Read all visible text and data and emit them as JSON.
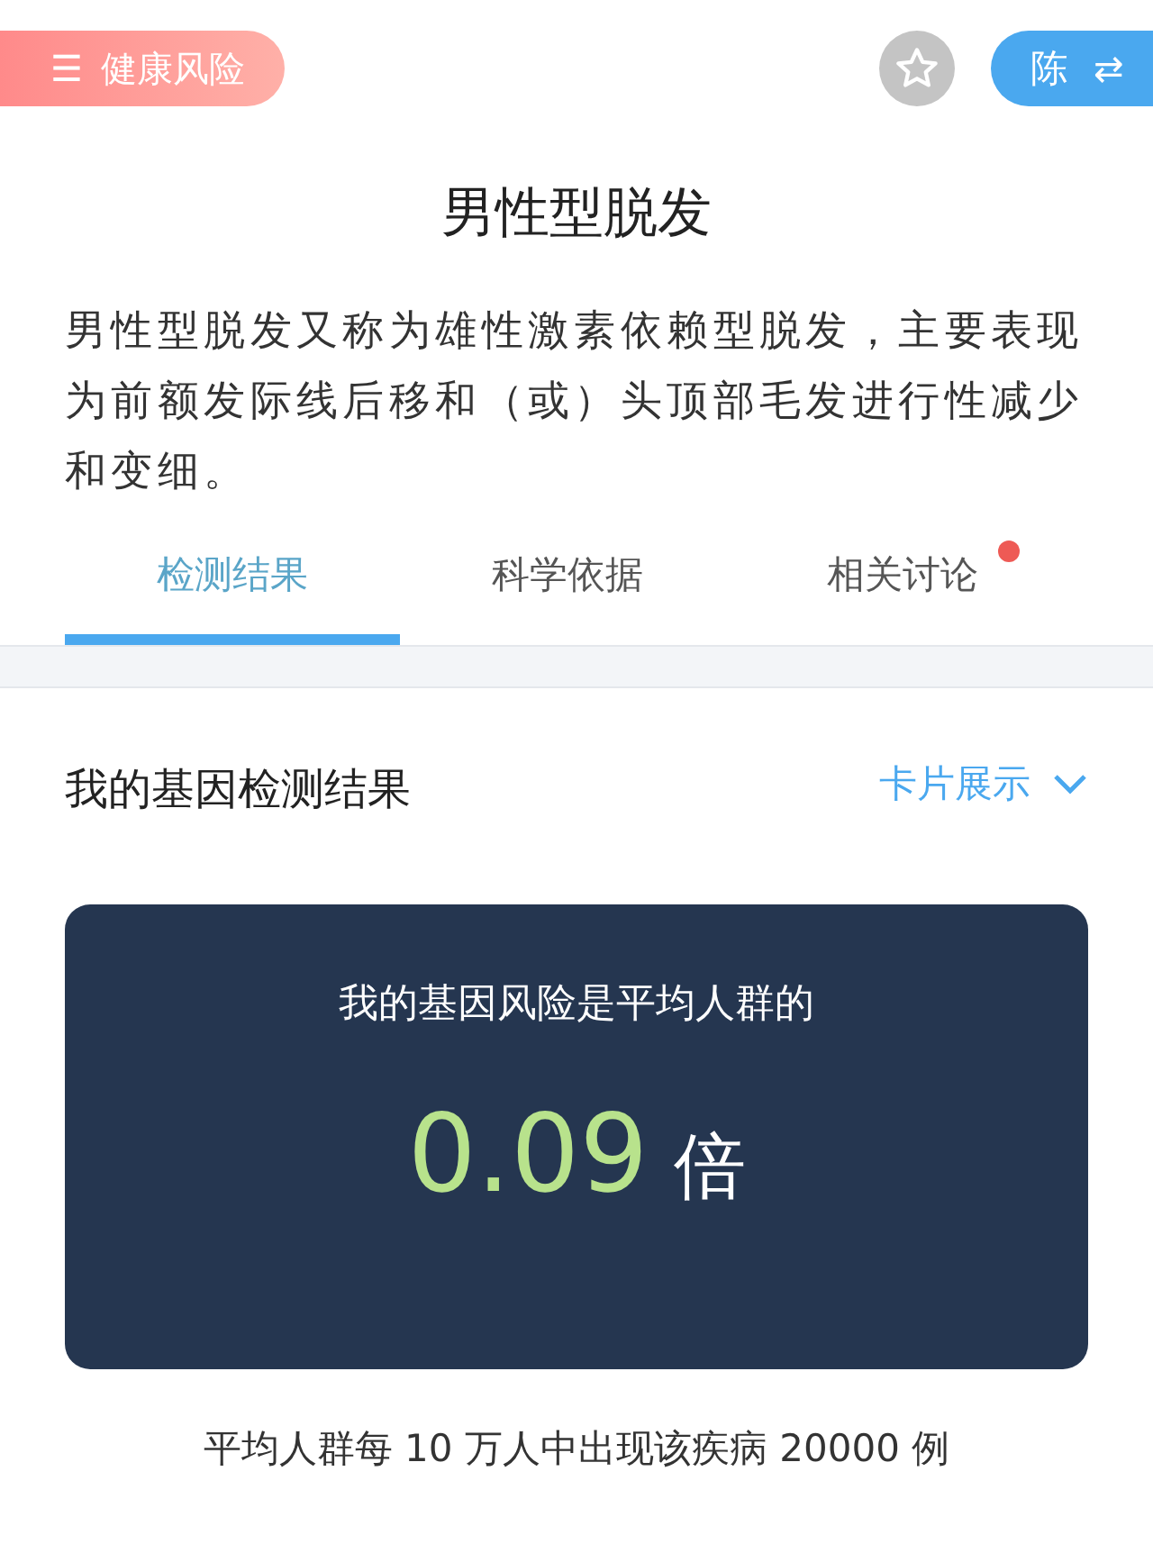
{
  "top_bar": {
    "category_button": {
      "icon": "☰",
      "label": "健康风险"
    },
    "favorite": {
      "selected": false
    },
    "user_switch": {
      "label": "陈",
      "icon": "⇄"
    }
  },
  "title": "男性型脱发",
  "description": "男性型脱发又称为雄性激素依赖型脱发，主要表现为前额发际线后移和（或）头顶部毛发进行性减少和变细。",
  "tabs": [
    {
      "label": "检测结果",
      "selected": true,
      "unread": false
    },
    {
      "label": "科学依据",
      "selected": false,
      "unread": false
    },
    {
      "label": "相关讨论",
      "selected": false,
      "unread": true
    }
  ],
  "section": {
    "title": "我的基因检测结果",
    "view_toggle": "卡片展示"
  },
  "risk_card": {
    "caption": "我的基因风险是平均人群的",
    "value": "0.09",
    "unit": "倍"
  },
  "footnote": "平均人群每 10 万人中出现该疾病 20000 例"
}
